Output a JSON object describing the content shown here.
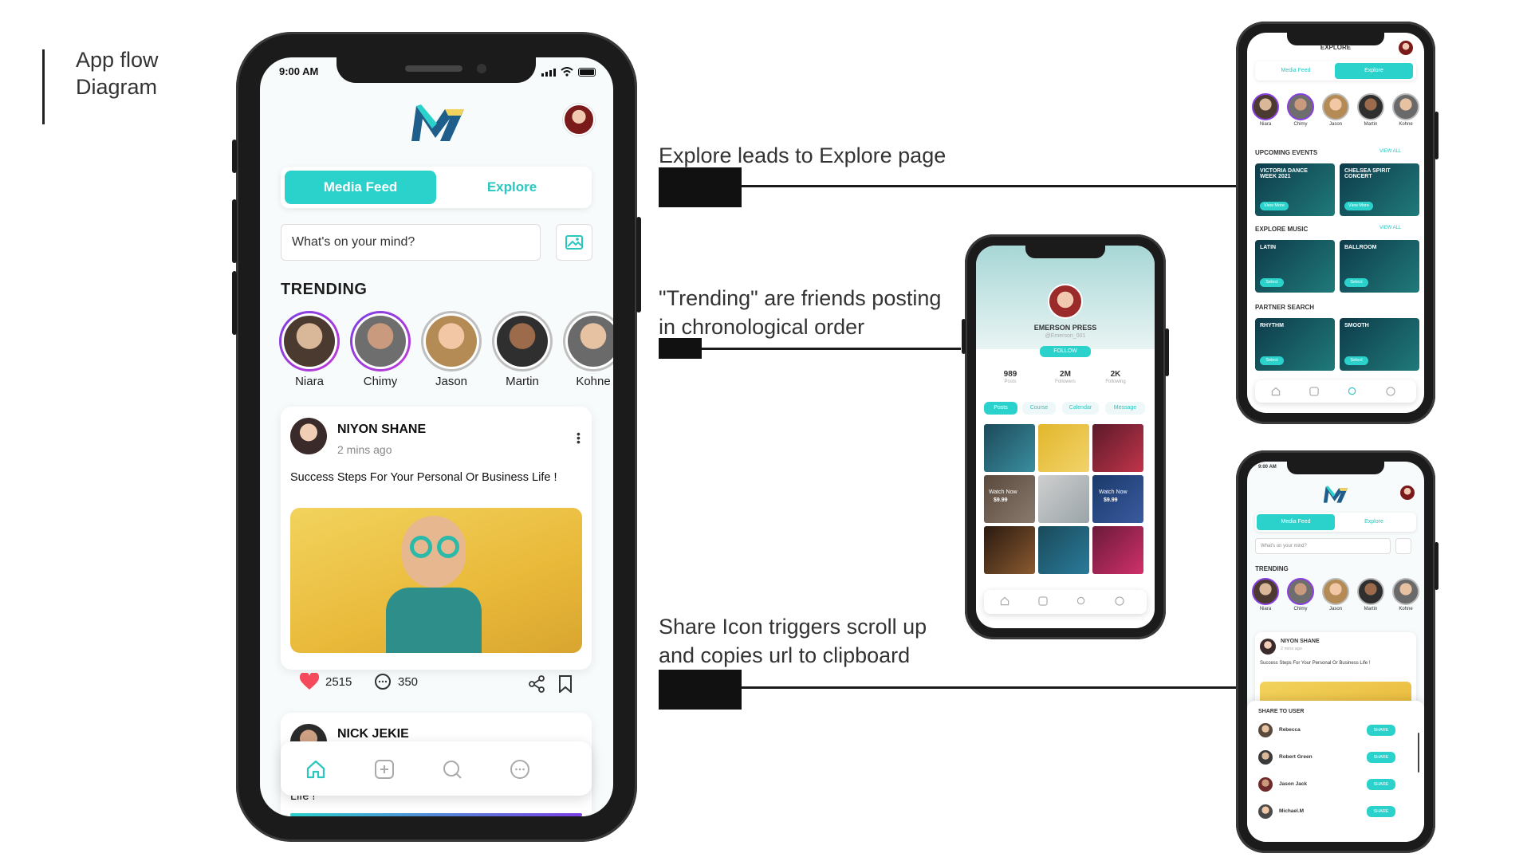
{
  "diagram_title": "App flow\nDiagram",
  "annotations": {
    "explore": "Explore leads to Explore page",
    "trending": "\"Trending\" are friends posting\nin chronological order",
    "share": "Share Icon triggers scroll up\nand copies url to clipboard"
  },
  "main_phone": {
    "status_time": "9:00 AM",
    "tabs": {
      "media_feed": "Media Feed",
      "explore": "Explore"
    },
    "composer_placeholder": "What's on your mind?",
    "trending_heading": "TRENDING",
    "stories": [
      {
        "name": "Niara"
      },
      {
        "name": "Chimy"
      },
      {
        "name": "Jason"
      },
      {
        "name": "Martin"
      },
      {
        "name": "Kohne"
      }
    ],
    "post": {
      "author": "NIYON SHANE",
      "time": "2 mins ago",
      "text": "Success Steps For Your Personal Or Business Life !",
      "likes": "2515",
      "comments": "350"
    },
    "next_post_author": "NICK JEKIE",
    "next_post_fragment": "Life !"
  },
  "profile_phone": {
    "name": "EMERSON PRESS",
    "handle": "@Emerson_001",
    "follow": "FOLLOW",
    "stats": [
      {
        "value": "989",
        "label": "Posts"
      },
      {
        "value": "2M",
        "label": "Followers"
      },
      {
        "value": "2K",
        "label": "Following"
      }
    ],
    "tabs": [
      "Posts",
      "Course",
      "Calendar",
      "Message"
    ],
    "watch_label": "Watch Now",
    "price_1": "$9.99",
    "price_2": "$9.99"
  },
  "explore_phone": {
    "title": "EXPLORE",
    "tabs": {
      "media_feed": "Media Feed",
      "explore": "Explore"
    },
    "stories": [
      "Niara",
      "Chimy",
      "Jason",
      "Martin",
      "Kohne"
    ],
    "upcoming_heading": "UPCOMING EVENTS",
    "view_all": "VIEW ALL",
    "events": [
      {
        "title": "VICTORIA DANCE WEEK 2021",
        "button": "View More"
      },
      {
        "title": "CHELSEA SPIRIT CONCERT",
        "button": "View More"
      }
    ],
    "music_heading": "EXPLORE MUSIC",
    "music": [
      {
        "title": "LATIN",
        "button": "Select"
      },
      {
        "title": "BALLROOM",
        "button": "Select"
      }
    ],
    "partner_heading": "PARTNER SEARCH",
    "partner": [
      {
        "title": "RHYTHM",
        "button": "Select"
      },
      {
        "title": "SMOOTH",
        "button": "Select"
      }
    ]
  },
  "share_phone": {
    "status_time": "9:00 AM",
    "tabs": {
      "media_feed": "Media Feed",
      "explore": "Explore"
    },
    "composer_placeholder": "What's on your mind?",
    "trending_heading": "TRENDING",
    "stories": [
      "Niara",
      "Chimy",
      "Jason",
      "Martin",
      "Kohne"
    ],
    "post_author": "NIYON SHANE",
    "post_time": "2 mins ago",
    "post_text": "Success Steps For Your Personal Or Business Life !",
    "share_heading": "SHARE TO USER",
    "share_button": "SHARE",
    "users": [
      "Rebecca",
      "Robert Green",
      "Jason Jack",
      "Michael.M"
    ]
  }
}
